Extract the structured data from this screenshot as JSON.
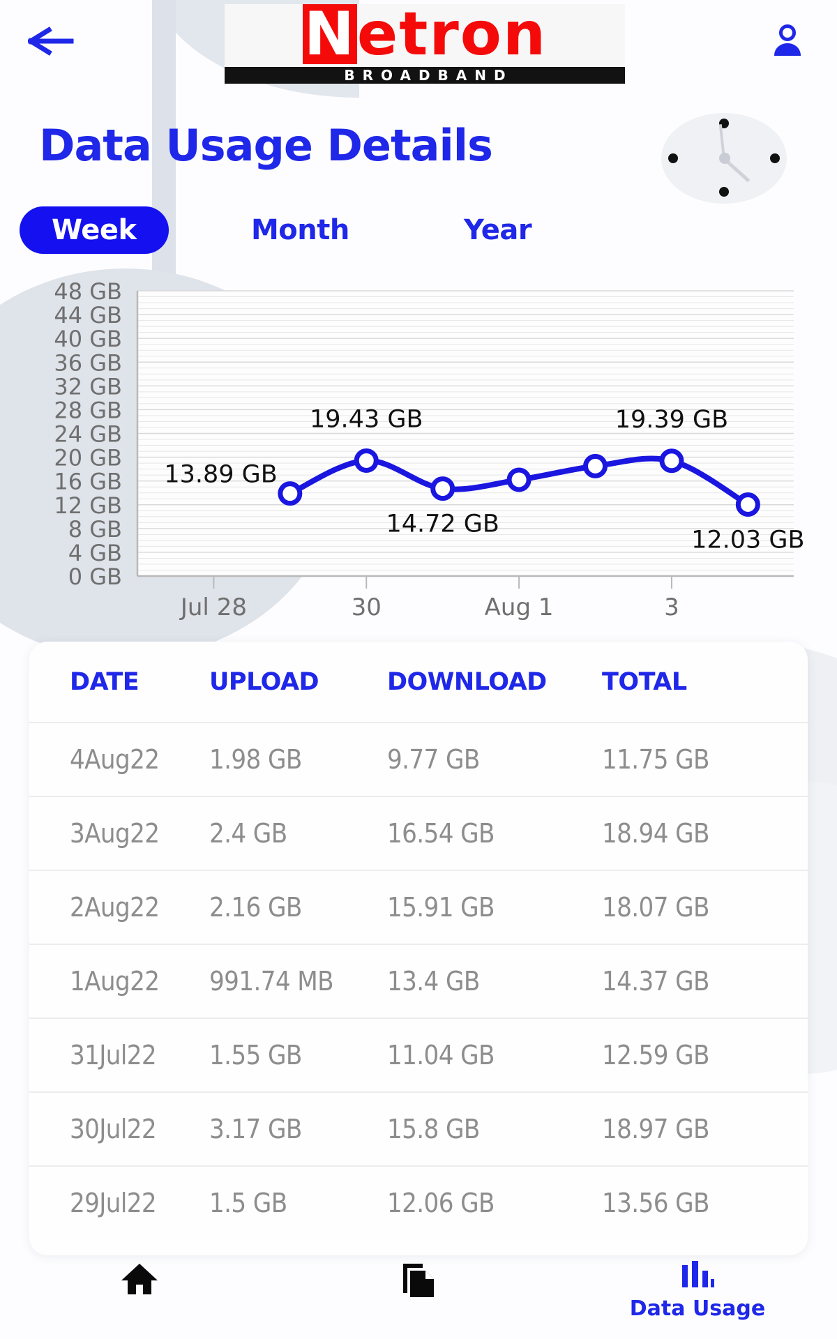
{
  "header": {
    "back_icon": "arrow-left-icon",
    "account_icon": "person-icon",
    "logo_word": "Netron",
    "logo_subtitle": "BROADBAND",
    "logo_red": "#f50a0a"
  },
  "page_title": "Data Usage Details",
  "accent_blue": "#1f27e8",
  "tab_active_bg": "#1410ef",
  "tabs": [
    {
      "label": "Week",
      "active": true
    },
    {
      "label": "Month",
      "active": false
    },
    {
      "label": "Year",
      "active": false
    }
  ],
  "chart_data": {
    "type": "line",
    "title": "",
    "xlabel": "",
    "ylabel": "",
    "ylim": [
      0,
      48
    ],
    "grid": true,
    "legend_position": "none",
    "yticks": [
      "0 GB",
      "4 GB",
      "8 GB",
      "12 GB",
      "16 GB",
      "20 GB",
      "24 GB",
      "28 GB",
      "32 GB",
      "36 GB",
      "40 GB",
      "44 GB",
      "48 GB"
    ],
    "ytick_values": [
      0,
      4,
      8,
      12,
      16,
      20,
      24,
      28,
      32,
      36,
      40,
      44,
      48
    ],
    "xtick_labels": [
      "Jul 28",
      "30",
      "Aug 1",
      "3"
    ],
    "xtick_values": [
      28,
      30,
      32,
      34
    ],
    "x": [
      29,
      30,
      31,
      32,
      33,
      34,
      35
    ],
    "values": [
      13.89,
      19.43,
      14.72,
      16.2,
      18.5,
      19.39,
      12.03
    ],
    "point_labels": [
      {
        "index": 0,
        "text": "13.89 GB",
        "position": "above-left"
      },
      {
        "index": 1,
        "text": "19.43 GB",
        "position": "above"
      },
      {
        "index": 2,
        "text": "14.72 GB",
        "position": "below"
      },
      {
        "index": 5,
        "text": "19.39 GB",
        "position": "above"
      },
      {
        "index": 6,
        "text": "12.03 GB",
        "position": "below"
      }
    ],
    "line_color": "#1a16e0",
    "marker_fill": "#ffffff",
    "plot_bg": "#fdfdfd",
    "gridline_color": "#d8d8d8",
    "gridline_step": 1
  },
  "table": {
    "columns": [
      "DATE",
      "UPLOAD",
      "DOWNLOAD",
      "TOTAL"
    ],
    "rows": [
      [
        "4Aug22",
        "1.98 GB",
        "9.77 GB",
        "11.75 GB"
      ],
      [
        "3Aug22",
        "2.4 GB",
        "16.54 GB",
        "18.94 GB"
      ],
      [
        "2Aug22",
        "2.16 GB",
        "15.91 GB",
        "18.07 GB"
      ],
      [
        "1Aug22",
        "991.74 MB",
        "13.4 GB",
        "14.37 GB"
      ],
      [
        "31Jul22",
        "1.55 GB",
        "11.04 GB",
        "12.59 GB"
      ],
      [
        "30Jul22",
        "3.17 GB",
        "15.8 GB",
        "18.97 GB"
      ],
      [
        "29Jul22",
        "1.5 GB",
        "12.06 GB",
        "13.56 GB"
      ]
    ]
  },
  "bottom_nav": [
    {
      "icon": "home-icon",
      "label": "",
      "active": false
    },
    {
      "icon": "copy-documents-icon",
      "label": "",
      "active": false
    },
    {
      "icon": "bar-chart-icon",
      "label": "Data Usage",
      "active": true
    }
  ]
}
